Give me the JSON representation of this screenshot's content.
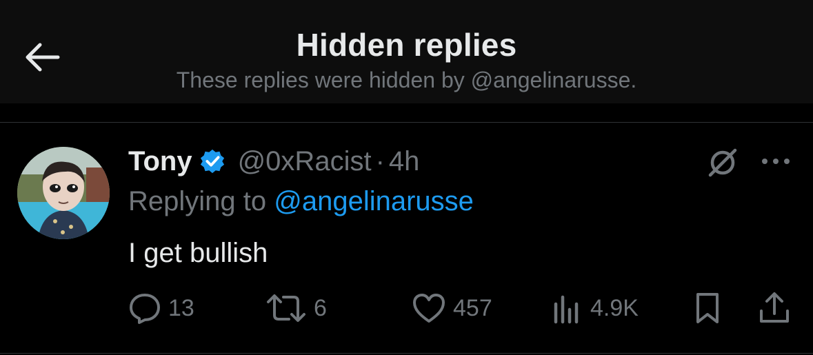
{
  "header": {
    "title": "Hidden replies",
    "subtitle": "These replies were hidden by @angelinarusse."
  },
  "tweet": {
    "name": "Tony",
    "handle": "@0xRacist",
    "separator": "·",
    "time": "4h",
    "replying_prefix": "Replying to ",
    "replying_to": "@angelinarusse",
    "text": "I get bullish",
    "actions": {
      "replies": "13",
      "reposts": "6",
      "likes": "457",
      "views": "4.9K"
    }
  },
  "icons": {
    "back": "arrow-left-icon",
    "verified": "verified-badge-icon",
    "hidden": "hide-slash-circle-icon",
    "more": "more-dots-icon",
    "reply": "reply-bubble-icon",
    "repost": "repost-icon",
    "like": "heart-icon",
    "views": "views-bar-chart-icon",
    "bookmark": "bookmark-icon",
    "share": "share-upload-icon"
  },
  "colors": {
    "background": "#000000",
    "header_bg": "#0d0d0d",
    "text": "#e7e9ea",
    "muted": "#71767b",
    "accent": "#1d9bf0"
  }
}
